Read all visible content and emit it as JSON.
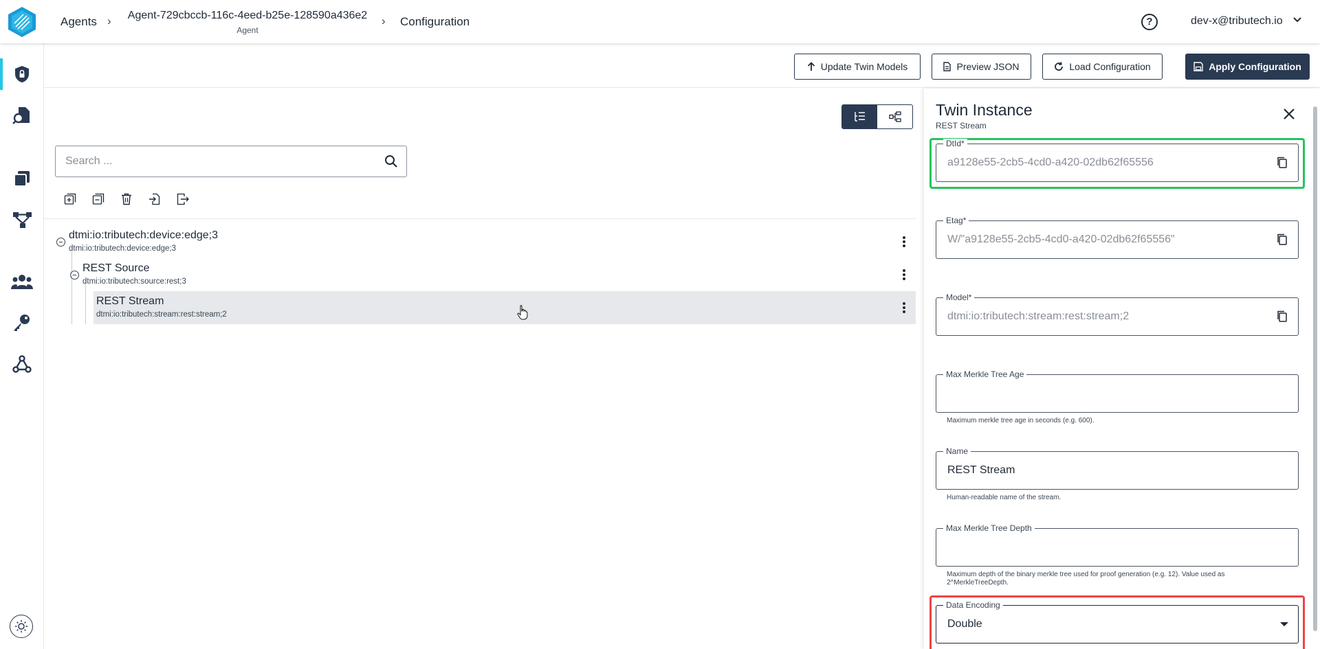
{
  "header": {
    "breadcrumbs": {
      "agents": "Agents",
      "agent_id": "Agent-729cbccb-116c-4eed-b25e-128590a436e2",
      "agent_sub": "Agent",
      "configuration": "Configuration"
    },
    "help_icon": "?",
    "user": "dev-x@tributech.io"
  },
  "toolbar": {
    "update_twin_models": "Update Twin Models",
    "preview_json": "Preview JSON",
    "load_configuration": "Load Configuration",
    "apply_configuration": "Apply Configuration"
  },
  "search": {
    "placeholder": "Search ..."
  },
  "tree": {
    "nodes": [
      {
        "title": "dtmi:io:tributech:device:edge;3",
        "subtitle": "dtmi:io:tributech:device:edge;3"
      },
      {
        "title": "REST Source",
        "subtitle": "dtmi:io:tributech:source:rest;3"
      },
      {
        "title": "REST Stream",
        "subtitle": "dtmi:io:tributech:stream:rest:stream;2"
      }
    ]
  },
  "panel": {
    "title": "Twin Instance",
    "subtitle": "REST Stream",
    "fields": [
      {
        "label": "DtId*",
        "value": "a9128e55-2cb5-4cd0-a420-02db62f65556"
      },
      {
        "label": "Etag*",
        "value": "W/\"a9128e55-2cb5-4cd0-a420-02db62f65556\""
      },
      {
        "label": "Model*",
        "value": "dtmi:io:tributech:stream:rest:stream;2"
      },
      {
        "label": "Max Merkle Tree Age",
        "value": "",
        "help": "Maximum merkle tree age in seconds (e.g. 600)."
      },
      {
        "label": "Name",
        "value": "REST Stream",
        "help": "Human-readable name of the stream."
      },
      {
        "label": "Max Merkle Tree Depth",
        "value": "",
        "help": "Maximum depth of the binary merkle tree used for proof generation (e.g. 12). Value used as 2^MerkleTreeDepth."
      },
      {
        "label": "Data Encoding",
        "value": "Double"
      }
    ]
  },
  "colors": {
    "primary": "#2a3a52",
    "accent": "#22c7e6",
    "highlight_green": "#22c55e",
    "highlight_red": "#ef4444"
  }
}
